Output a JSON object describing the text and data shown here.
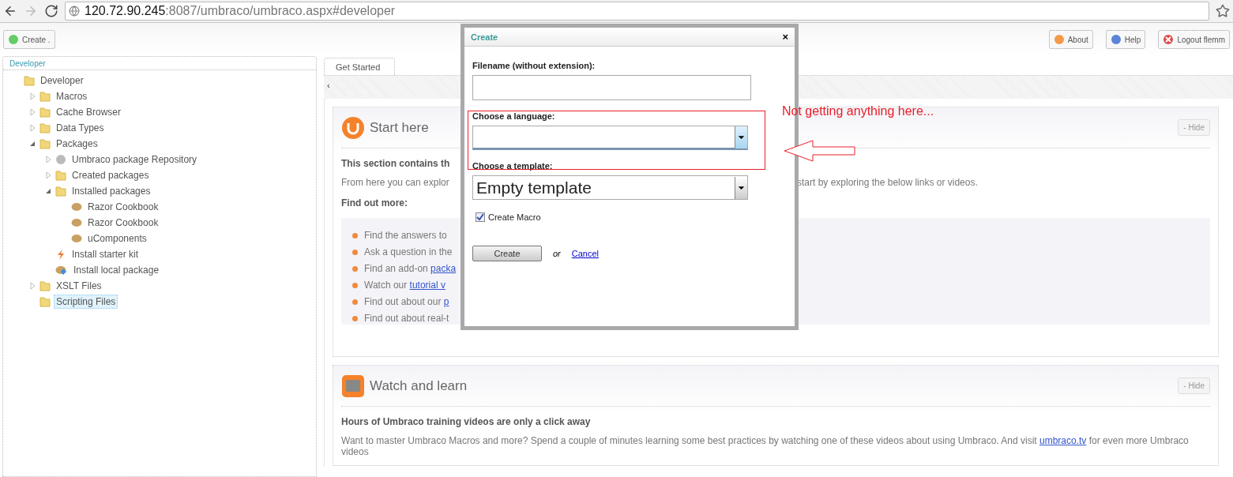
{
  "browser": {
    "url_host": "120.72.90.245",
    "url_rest": ":8087/umbraco/umbraco.aspx#developer"
  },
  "toolbar": {
    "create_button": "Create .",
    "right_buttons": [
      {
        "kind": "about",
        "label": "About"
      },
      {
        "kind": "help",
        "label": "Help"
      },
      {
        "kind": "logout",
        "label": "Logout  flemm"
      }
    ]
  },
  "sidebar": {
    "title": "Developer",
    "tree": [
      {
        "label": "Developer",
        "kind": "folder",
        "selected": false,
        "children": [
          {
            "label": "Macros",
            "kind": "folder",
            "expanded": false,
            "selected": false
          },
          {
            "label": "Cache Browser",
            "kind": "folder",
            "expanded": false,
            "selected": false
          },
          {
            "label": "Data Types",
            "kind": "folder",
            "expanded": false,
            "selected": false
          },
          {
            "label": "Packages",
            "kind": "folder",
            "expanded": true,
            "selected": false,
            "children": [
              {
                "label": "Umbraco package Repository",
                "kind": "repository",
                "expanded": false,
                "selected": false
              },
              {
                "label": "Created packages",
                "kind": "folder",
                "expanded": false,
                "selected": false
              },
              {
                "label": "Installed packages",
                "kind": "folder",
                "expanded": true,
                "selected": false,
                "children": [
                  {
                    "label": "Razor Cookbook",
                    "kind": "package",
                    "selected": false
                  },
                  {
                    "label": "Razor Cookbook",
                    "kind": "package",
                    "selected": false
                  },
                  {
                    "label": "uComponents",
                    "kind": "package",
                    "selected": false
                  }
                ]
              },
              {
                "label": "Install starter kit",
                "kind": "starter-kit",
                "selected": false
              },
              {
                "label": "Install local package",
                "kind": "local-package",
                "selected": false
              }
            ]
          },
          {
            "label": "XSLT Files",
            "kind": "folder",
            "expanded": false,
            "selected": false
          },
          {
            "label": "Scripting Files",
            "kind": "folder",
            "selected": true
          }
        ]
      }
    ]
  },
  "tabs": [
    {
      "label": "Get Started",
      "selected": true
    }
  ],
  "tab_strip": {
    "scroll_left": "‹"
  },
  "start_panel": {
    "title": "Start here",
    "hide_button": "- Hide",
    "intro_heading": "This section contains th",
    "intro_left": "From here you can explor",
    "intro_right": "start by exploring the below links or videos.",
    "subheading": "Find out more:",
    "items": [
      {
        "text": "Find the answers to "
      },
      {
        "text": "Ask a question in the"
      },
      {
        "text": "Find an add-on ",
        "link": "packa"
      },
      {
        "text": "Watch our ",
        "link": "tutorial v"
      },
      {
        "text": "Find out about our ",
        "link": "p"
      },
      {
        "text": "Find out about real-t"
      }
    ]
  },
  "video_panel": {
    "title": "Watch and learn",
    "hide_button": "- Hide",
    "heading": "Hours of Umbraco training videos are only a click away",
    "text_before": "Want to master Umbraco Macros and more? Spend a couple of minutes learning some best practices by watching one of these videos about using Umbraco. And visit ",
    "link": "umbraco.tv",
    "text_after": " for even more Umbraco videos"
  },
  "dialog": {
    "title": "Create",
    "close": "×",
    "filename_label": "Filename (without extension):",
    "language_label": "Choose a language:",
    "template_label": "Choose a template:",
    "template_value": "Empty template",
    "create_macro": {
      "label": "Create Macro",
      "checked": true
    },
    "create_button": "Create",
    "or": "or",
    "cancel": "Cancel"
  },
  "annotation": {
    "text": "Not getting anything here..."
  }
}
